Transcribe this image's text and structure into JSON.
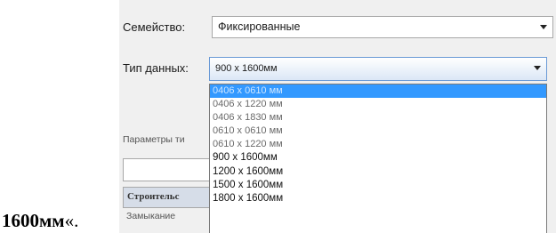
{
  "outer_text": {
    "bold": "1600мм",
    "rest": "«."
  },
  "family": {
    "label": "Семейство:",
    "value": "Фиксированные"
  },
  "type": {
    "label": "Тип данных:",
    "value": "900 x 1600мм"
  },
  "params_label": "Параметры ти",
  "table": {
    "header": "Строительс",
    "row1": "Замыкание"
  },
  "dropdown": {
    "selected_index": 0,
    "options": [
      "0406 x 0610 мм",
      "0406 x 1220 мм",
      "0406 x 1830 мм",
      "0610 x 0610 мм",
      "0610 x 1220 мм",
      "900 x 1600мм",
      "1200 x 1600мм",
      "1500 x 1600мм",
      "1800 x 1600мм"
    ]
  }
}
